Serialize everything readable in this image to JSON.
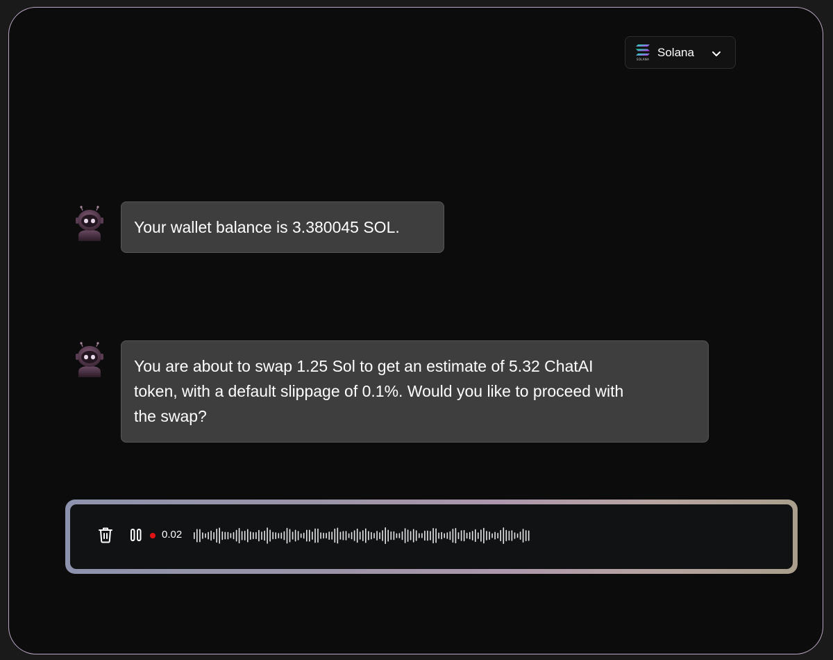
{
  "network": {
    "label": "Solana",
    "logo_word": "SOLANA",
    "icon": "solana-logo-icon",
    "dropdown_icon": "chevron-down-icon"
  },
  "messages": [
    {
      "sender": "assistant",
      "avatar_icon": "robot-avatar-icon",
      "text": "Your wallet balance is 3.380045 SOL."
    },
    {
      "sender": "assistant",
      "avatar_icon": "robot-avatar-icon",
      "text_lines": [
        "You are about to swap 1.25 Sol to get an estimate of 5.32 ChatAI",
        "token, with a default slippage of 0.1%. Would you like to proceed with",
        "the swap?"
      ]
    }
  ],
  "recorder": {
    "delete_icon": "trash-icon",
    "pause_icon": "pause-icon",
    "recording_indicator": "recording-dot",
    "elapsed": "0.02",
    "waveform_icon": "audio-waveform"
  },
  "colors": {
    "background": "#0c0c0c",
    "bubble": "#3e3e3e",
    "recording_dot": "#e01414",
    "frame_border": "#b9a6c4"
  }
}
